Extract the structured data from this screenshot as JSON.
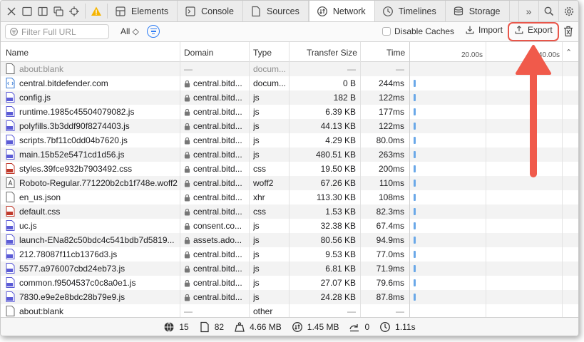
{
  "tabs": [
    {
      "label": "Elements",
      "icon": "elements-icon"
    },
    {
      "label": "Console",
      "icon": "console-icon"
    },
    {
      "label": "Sources",
      "icon": "sources-icon"
    },
    {
      "label": "Network",
      "icon": "network-icon",
      "active": true
    },
    {
      "label": "Timelines",
      "icon": "timelines-icon"
    },
    {
      "label": "Storage",
      "icon": "storage-icon"
    }
  ],
  "toolbar": {
    "more_label": "»",
    "search_placeholder": "Filter Full URL",
    "all_label": "All ◇",
    "disable_caches_label": "Disable Caches",
    "import_label": "Import",
    "export_label": "Export"
  },
  "columns": {
    "name": "Name",
    "domain": "Domain",
    "type": "Type",
    "transfer_size": "Transfer Size",
    "time": "Time"
  },
  "timeline": {
    "tick1": "20.00s",
    "tick2": "40.00s"
  },
  "rows": [
    {
      "name": "about:blank",
      "domain": "—",
      "type": "docum...",
      "size": "—",
      "time": "—",
      "icon": "file-icon",
      "muted": true,
      "lock": false
    },
    {
      "name": "central.bitdefender.com",
      "domain": "central.bitd...",
      "type": "docum...",
      "size": "0 B",
      "time": "244ms",
      "icon": "html-icon",
      "lock": true
    },
    {
      "name": "config.js",
      "domain": "central.bitd...",
      "type": "js",
      "size": "182 B",
      "time": "122ms",
      "icon": "js-icon",
      "lock": true
    },
    {
      "name": "runtime.1985c45504079082.js",
      "domain": "central.bitd...",
      "type": "js",
      "size": "6.39 KB",
      "time": "177ms",
      "icon": "js-icon",
      "lock": true
    },
    {
      "name": "polyfills.3b3ddf90f8274403.js",
      "domain": "central.bitd...",
      "type": "js",
      "size": "44.13 KB",
      "time": "122ms",
      "icon": "js-icon",
      "lock": true
    },
    {
      "name": "scripts.7bf11c0dd04b7620.js",
      "domain": "central.bitd...",
      "type": "js",
      "size": "4.29 KB",
      "time": "80.0ms",
      "icon": "js-icon",
      "lock": true
    },
    {
      "name": "main.15b52e5471cd1d56.js",
      "domain": "central.bitd...",
      "type": "js",
      "size": "480.51 KB",
      "time": "263ms",
      "icon": "js-icon",
      "lock": true
    },
    {
      "name": "styles.39fce932b7903492.css",
      "domain": "central.bitd...",
      "type": "css",
      "size": "19.50 KB",
      "time": "200ms",
      "icon": "css-icon",
      "lock": true
    },
    {
      "name": "Roboto-Regular.771220b2cb1f748e.woff2",
      "domain": "central.bitd...",
      "type": "woff2",
      "size": "67.26 KB",
      "time": "110ms",
      "icon": "font-icon",
      "lock": true
    },
    {
      "name": "en_us.json",
      "domain": "central.bitd...",
      "type": "xhr",
      "size": "113.30 KB",
      "time": "108ms",
      "icon": "file-icon",
      "lock": true
    },
    {
      "name": "default.css",
      "domain": "central.bitd...",
      "type": "css",
      "size": "1.53 KB",
      "time": "82.3ms",
      "icon": "css-icon",
      "lock": true
    },
    {
      "name": "uc.js",
      "domain": "consent.co...",
      "type": "js",
      "size": "32.38 KB",
      "time": "67.4ms",
      "icon": "js-icon",
      "lock": true
    },
    {
      "name": "launch-ENa82c50bdc4c541bdb7d5819...",
      "domain": "assets.ado...",
      "type": "js",
      "size": "80.56 KB",
      "time": "94.9ms",
      "icon": "js-icon",
      "lock": true
    },
    {
      "name": "212.78087f11cb1376d3.js",
      "domain": "central.bitd...",
      "type": "js",
      "size": "9.53 KB",
      "time": "77.0ms",
      "icon": "js-icon",
      "lock": true
    },
    {
      "name": "5577.a976007cbd24eb73.js",
      "domain": "central.bitd...",
      "type": "js",
      "size": "6.81 KB",
      "time": "71.9ms",
      "icon": "js-icon",
      "lock": true
    },
    {
      "name": "common.f9504537c0c8a0e1.js",
      "domain": "central.bitd...",
      "type": "js",
      "size": "27.07 KB",
      "time": "79.6ms",
      "icon": "js-icon",
      "lock": true
    },
    {
      "name": "7830.e9e2e8bdc28b79e9.js",
      "domain": "central.bitd...",
      "type": "js",
      "size": "24.28 KB",
      "time": "87.8ms",
      "icon": "js-icon",
      "lock": true
    },
    {
      "name": "about:blank",
      "domain": "—",
      "type": "other",
      "size": "—",
      "time": "—",
      "icon": "file-icon",
      "muted": false,
      "lock": false
    }
  ],
  "status": {
    "domains": "15",
    "resources": "82",
    "resource_size": "4.66 MB",
    "transferred": "1.45 MB",
    "redirects": "0",
    "load_time": "1.11s"
  },
  "colors": {
    "accent": "#2f7ef5",
    "highlight": "#e8564a",
    "waterfall": "#6aa8e8"
  }
}
